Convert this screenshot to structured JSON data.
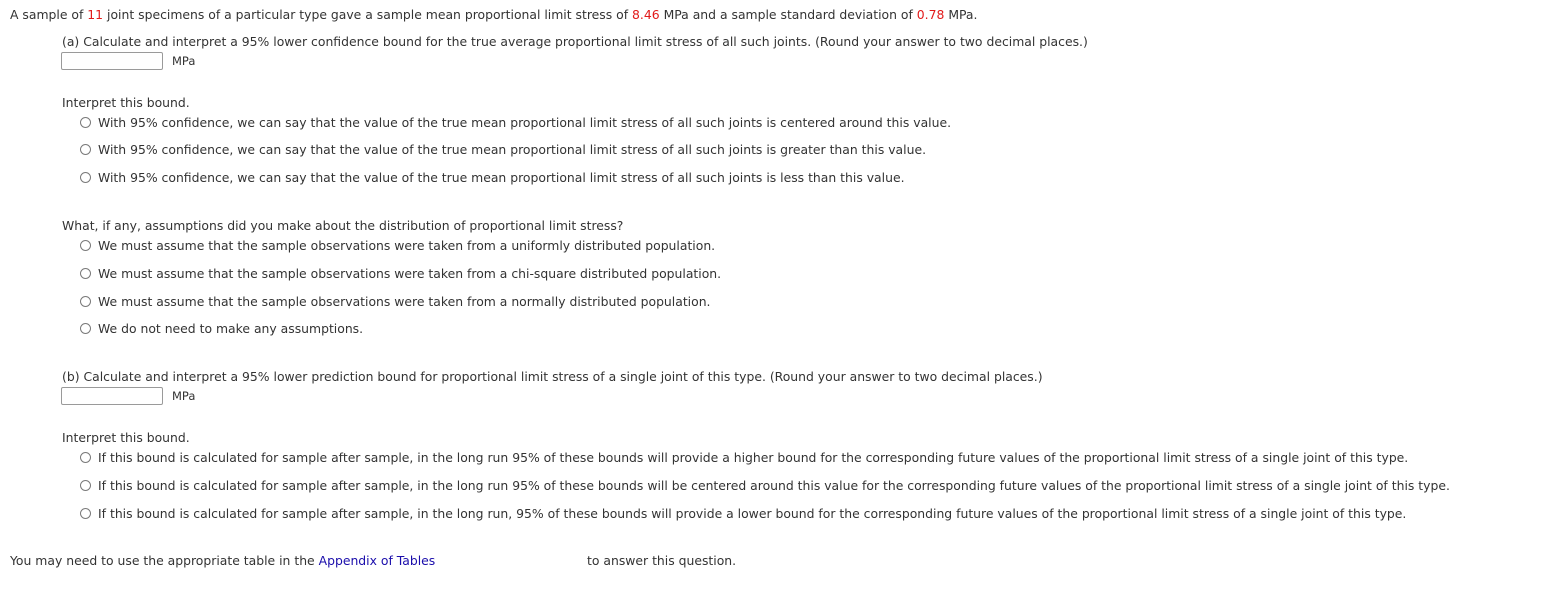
{
  "intro": {
    "part1": "A sample of ",
    "n": "11",
    "part2": " joint specimens of a particular type gave a sample mean proportional limit stress of ",
    "mean": "8.46",
    "part3": " MPa and a sample standard deviation of ",
    "sd": "0.78",
    "part4": " MPa."
  },
  "part_a": {
    "prompt": "(a) Calculate and interpret a 95% lower confidence bound for the true average proportional limit stress of all such joints. (Round your answer to two decimal places.)",
    "input_value": "",
    "unit": "MPa",
    "interpret_label": "Interpret this bound.",
    "options": [
      "With 95% confidence, we can say that the value of the true mean proportional limit stress of all such joints is centered around this value.",
      "With 95% confidence, we can say that the value of the true mean proportional limit stress of all such joints is greater than this value.",
      "With 95% confidence, we can say that the value of the true mean proportional limit stress of all such joints is less than this value."
    ],
    "assumption_label": "What, if any, assumptions did you make about the distribution of proportional limit stress?",
    "assumption_options": [
      "We must assume that the sample observations were taken from a uniformly distributed population.",
      "We must assume that the sample observations were taken from a chi-square distributed population.",
      "We must assume that the sample observations were taken from a normally distributed population.",
      "We do not need to make any assumptions."
    ]
  },
  "part_b": {
    "prompt": "(b) Calculate and interpret a 95% lower prediction bound for proportional limit stress of a single joint of this type. (Round your answer to two decimal places.)",
    "input_value": "",
    "unit": "MPa",
    "interpret_label": "Interpret this bound.",
    "options": [
      "If this bound is calculated for sample after sample, in the long run 95% of these bounds will provide a higher bound for the corresponding future values of the proportional limit stress of a single joint of this type.",
      "If this bound is calculated for sample after sample, in the long run 95% of these bounds will be centered around this value for the corresponding future values of the proportional limit stress of a single joint of this type.",
      "If this bound is calculated for sample after sample, in the long run, 95% of these bounds will provide a lower bound for the corresponding future values of the proportional limit stress of a single joint of this type."
    ]
  },
  "footer": {
    "before": "You may need to use the appropriate table in the ",
    "link": "Appendix of Tables",
    "after": "to answer this question."
  },
  "colors": {
    "highlight": "#e21a1a",
    "link": "#1a0dab",
    "text": "#333333"
  }
}
